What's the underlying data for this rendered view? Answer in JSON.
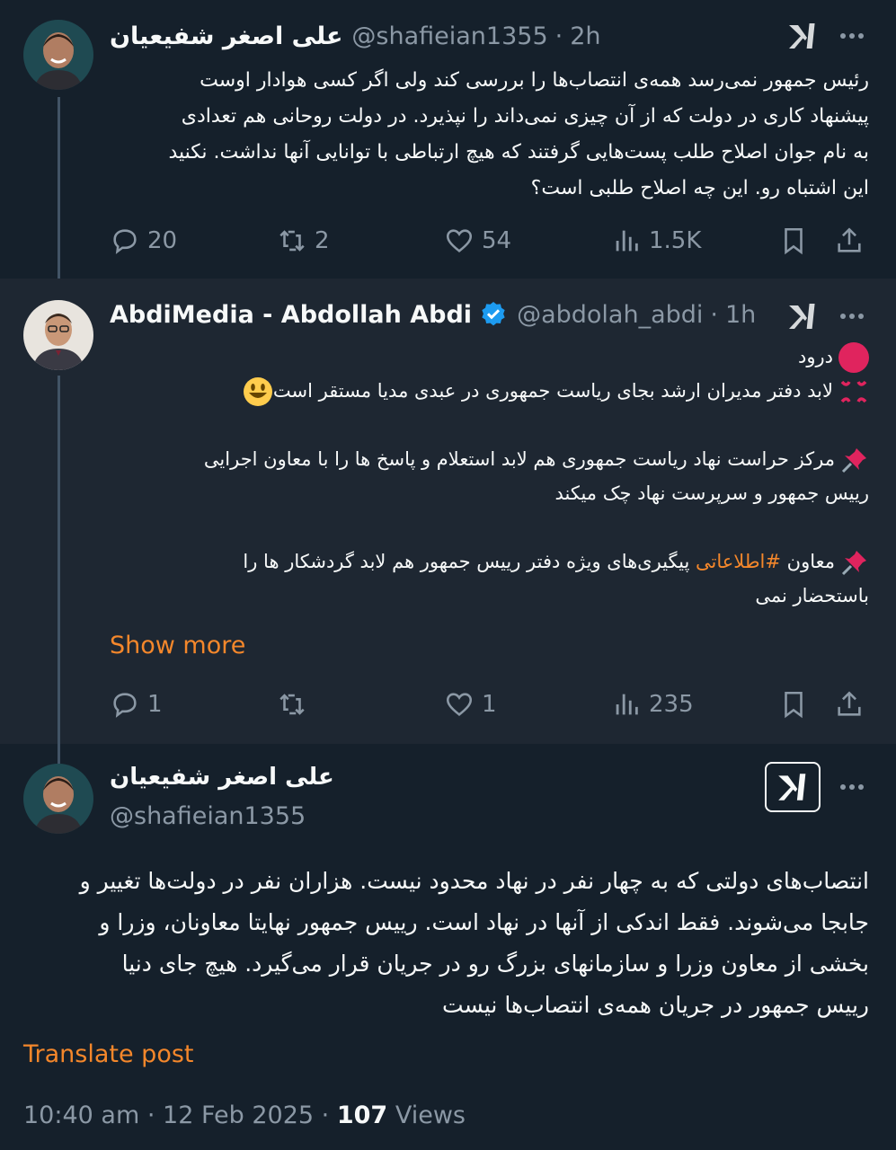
{
  "tweet1": {
    "name": "علی اصغر شفیعیان",
    "handle": "@shafieian1355",
    "dot": "·",
    "time": "2h",
    "lines": [
      "رئیس جمهور نمی‌رسد همه‌ی انتصاب‌ها را بررسی کند ولی اگر کسی هوادار اوست",
      "پیشنهاد کاری در دولت که از آن چیزی نمی‌داند را نپذیرد. در دولت روحانی هم تعدادی",
      "به نام جوان اصلاح طلب پست‌هایی گرفتند که هیچ ارتباطی با توانایی آنها نداشت. نکنید",
      "این اشتباه رو. این چه اصلاح طلبی است؟"
    ],
    "actions": {
      "replies": "20",
      "reposts": "2",
      "likes": "54",
      "views": "1.5K"
    }
  },
  "tweet2": {
    "name": "AbdiMedia - Abdollah Abdi",
    "handle": "@abdolah_abdi",
    "dot": "·",
    "time": "1h",
    "line1": "درود",
    "line2": "لابد دفتر مدیران ارشد بجای ریاست جمهوری در عبدی مدیا مستقر است",
    "line3a": "مرکز حراست نهاد ریاست جمهوری هم لابد استعلام و پاسخ ها را با معاون اجرایی",
    "line3b": "رییس جمهور و سرپرست نهاد چک میکند",
    "line4a_pre": "معاون",
    "line4a_tag": "#اطلاعاتی",
    "line4a_post": "پیگیری‌های ویژه دفتر رییس جمهور هم لابد گردشکار ها را",
    "line4b": "باستحضار نمی",
    "show_more": "Show more",
    "actions": {
      "replies": "1",
      "reposts": "",
      "likes": "1",
      "views": "235"
    }
  },
  "tweet3": {
    "name": "علی اصغر شفیعیان",
    "handle": "@shafieian1355",
    "lines": [
      "انتصاب‌های دولتی که به چهار نفر در نهاد محدود نیست. هزاران نفر در دولت‌ها تغییر و",
      "جابجا می‌شوند. فقط اندکی از آنها در نهاد است. رییس جمهور نهایتا معاونان، وزرا و",
      "بخشی از معاون وزرا و سازمانهای بزرگ رو در جریان قرار می‌گیرد. هیچ جای دنیا",
      "رییس جمهور در جریان همه‌ی انتصاب‌ها نیست"
    ],
    "translate": "Translate post",
    "time": "10:40 am",
    "dot": "·",
    "date": "12 Feb 2025",
    "views_count": "107",
    "views_label": "Views"
  },
  "colors": {
    "accent": "#f4872b",
    "verified": "#1d9bf0",
    "background": "#15202b",
    "highlight": "#1e2732"
  }
}
